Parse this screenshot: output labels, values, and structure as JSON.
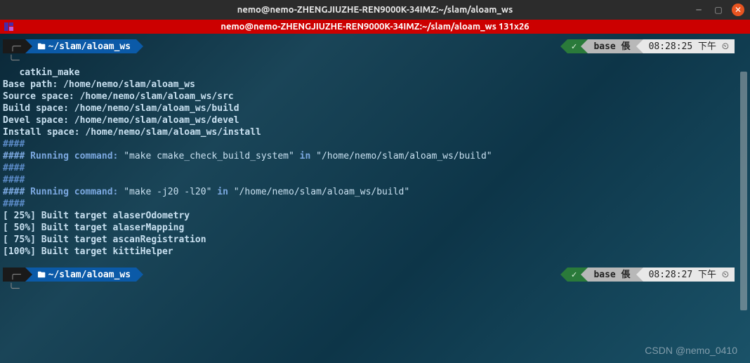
{
  "window": {
    "title": "nemo@nemo-ZHENGJIUZHE-REN9000K-34IMZ:~/slam/aloam_ws"
  },
  "statusbar": {
    "text": "nemo@nemo-ZHENGJIUZHE-REN9000K-34IMZ:~/slam/aloam_ws 131x26"
  },
  "prompt1": {
    "path": "~/slam/aloam_ws",
    "check": "✓",
    "env": "base 倀",
    "time": "08:28:25 下午",
    "clock": "⏲"
  },
  "prompt2": {
    "path": "~/slam/aloam_ws",
    "check": "✓",
    "env": "base 倀",
    "time": "08:28:27 下午",
    "clock": "⏲"
  },
  "output": {
    "cmd_indent": "   ",
    "cmd": "catkin_make",
    "base_path": "Base path: /home/nemo/slam/aloam_ws",
    "source_space": "Source space: /home/nemo/slam/aloam_ws/src",
    "build_space": "Build space: /home/nemo/slam/aloam_ws/build",
    "devel_space": "Devel space: /home/nemo/slam/aloam_ws/devel",
    "install_space": "Install space: /home/nemo/slam/aloam_ws/install",
    "hash": "####",
    "running1_a": "#### Running command: ",
    "running1_b": "\"make cmake_check_build_system\"",
    "running1_c": " in ",
    "running1_d": "\"/home/nemo/slam/aloam_ws/build\"",
    "running2_a": "#### Running command: ",
    "running2_b": "\"make -j20 -l20\"",
    "running2_c": " in ",
    "running2_d": "\"/home/nemo/slam/aloam_ws/build\"",
    "b25": "[ 25%] Built target alaserOdometry",
    "b50": "[ 50%] Built target alaserMapping",
    "b75": "[ 75%] Built target ascanRegistration",
    "b100": "[100%] Built target kittiHelper"
  },
  "watermark": "CSDN @nemo_0410"
}
